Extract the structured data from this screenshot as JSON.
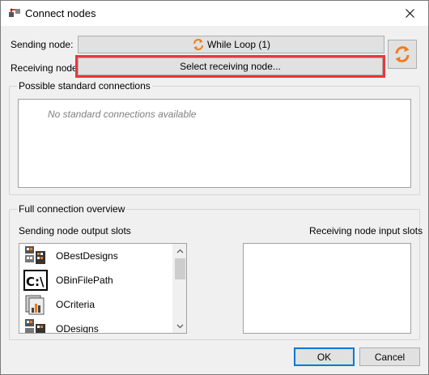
{
  "window": {
    "title": "Connect nodes",
    "close_icon": "close-icon"
  },
  "sending": {
    "label": "Sending node:",
    "value": "While Loop (1)",
    "icon": "loop-arrows-icon"
  },
  "receiving": {
    "label": "Receiving node:",
    "placeholder": "Select receiving node..."
  },
  "swap_icon": "swap-arrows-icon",
  "standard_connections": {
    "title": "Possible standard connections",
    "empty_text": "No standard connections available"
  },
  "overview": {
    "title": "Full connection overview",
    "sending_slots_label": "Sending node output slots",
    "receiving_slots_label": "Receiving node input slots",
    "sending_slots": [
      {
        "name": "OBestDesigns",
        "icon": "designs-table-icon"
      },
      {
        "name": "OBinFilePath",
        "icon": "file-path-icon"
      },
      {
        "name": "OCriteria",
        "icon": "criteria-chart-icon"
      },
      {
        "name": "ODesigns",
        "icon": "designs-table-icon"
      }
    ]
  },
  "buttons": {
    "ok": "OK",
    "cancel": "Cancel"
  },
  "colors": {
    "highlight": "#e8373c",
    "accent_orange": "#f07c1c",
    "focus_blue": "#0078d7"
  }
}
